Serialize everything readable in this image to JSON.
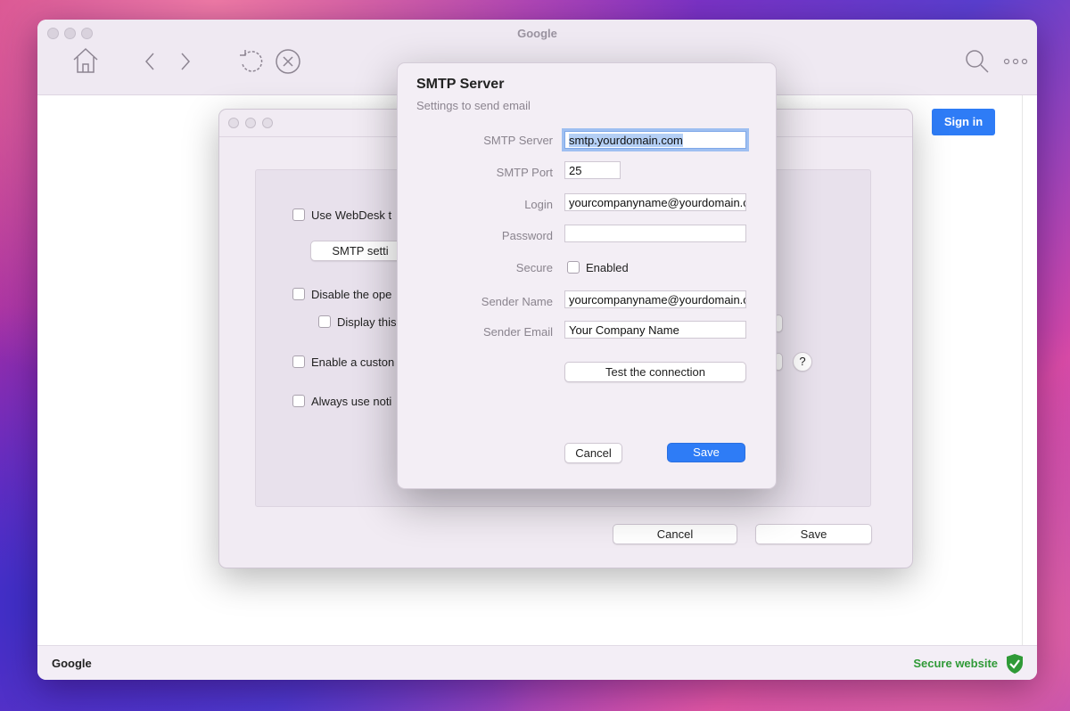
{
  "browser": {
    "title": "Google",
    "status_left": "Google",
    "status_right": "Secure website",
    "sign_in_label": "Sign in"
  },
  "settings_dialog": {
    "options": [
      "Use WebDesk t",
      "Disable the ope",
      "Display this",
      "Enable a custon",
      "Always use noti"
    ],
    "smtp_settings_label": "SMTP setti",
    "help_label": "?",
    "cancel_label": "Cancel",
    "save_label": "Save"
  },
  "smtp_dialog": {
    "title": "SMTP Server",
    "subtitle": "Settings to send email",
    "fields": {
      "smtp_server": {
        "label": "SMTP Server",
        "value": "smtp.yourdomain.com"
      },
      "smtp_port": {
        "label": "SMTP Port",
        "value": "25"
      },
      "login": {
        "label": "Login",
        "value": "yourcompanyname@yourdomain.com"
      },
      "password": {
        "label": "Password",
        "value": ""
      },
      "secure": {
        "label": "Secure",
        "checkbox_label": "Enabled",
        "checked": false
      },
      "sender_name": {
        "label": "Sender Name",
        "value": "yourcompanyname@yourdomain.com"
      },
      "sender_email": {
        "label": "Sender Email",
        "value": "Your Company Name"
      }
    },
    "test_label": "Test the connection",
    "cancel_label": "Cancel",
    "save_label": "Save"
  }
}
